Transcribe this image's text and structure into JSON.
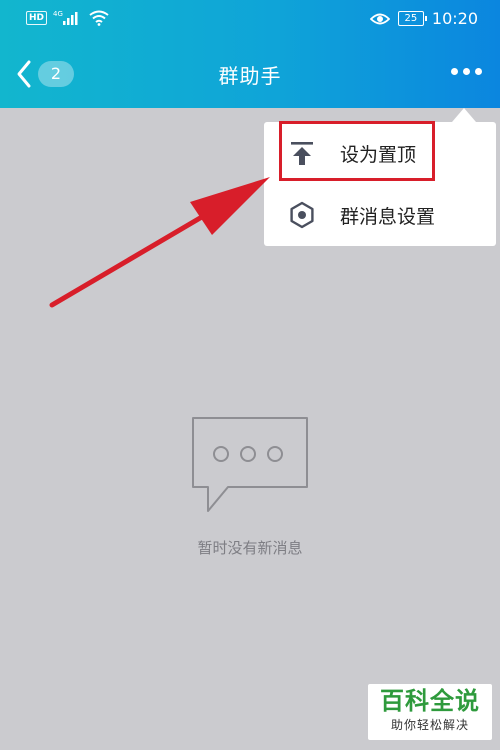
{
  "status_bar": {
    "hd": "HD",
    "network": "4G",
    "battery": "25",
    "time": "10:20"
  },
  "nav": {
    "back_count": "2",
    "title": "群助手"
  },
  "menu": {
    "items": [
      {
        "label": "设为置顶",
        "icon": "pin-to-top-icon"
      },
      {
        "label": "群消息设置",
        "icon": "hexagon-settings-icon"
      }
    ]
  },
  "empty_state": {
    "text": "暂时没有新消息",
    "icon": "chat-bubble-icon"
  },
  "watermark": {
    "title": "百科全说",
    "subtitle": "助你轻松解决"
  },
  "colors": {
    "header_start": "#12b6ce",
    "header_end": "#0b86df",
    "background": "#cbcbcf",
    "annotation_red": "#d81e2a",
    "watermark_green": "#2e9a3c"
  }
}
